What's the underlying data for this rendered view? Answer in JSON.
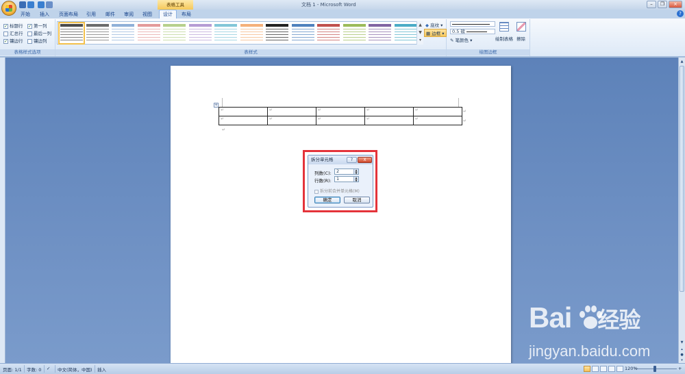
{
  "window": {
    "title": "文档 1 - Microsoft Word",
    "context_tool": "表格工具"
  },
  "tabs": [
    {
      "label": "开始"
    },
    {
      "label": "插入"
    },
    {
      "label": "页面布局"
    },
    {
      "label": "引用"
    },
    {
      "label": "邮件"
    },
    {
      "label": "审阅"
    },
    {
      "label": "视图"
    },
    {
      "label": "设计",
      "active": true
    },
    {
      "label": "布局"
    }
  ],
  "ribbon": {
    "style_options": {
      "group_label": "表格样式选项",
      "items": [
        {
          "label": "标题行",
          "checked": true
        },
        {
          "label": "第一列",
          "checked": true
        },
        {
          "label": "汇总行",
          "checked": false
        },
        {
          "label": "最后一列",
          "checked": false
        },
        {
          "label": "镶边行",
          "checked": true
        },
        {
          "label": "镶边列",
          "checked": false
        }
      ]
    },
    "table_styles": {
      "group_label": "表样式",
      "tiles": [
        {
          "color": "#4a4a4a"
        },
        {
          "color": "#6b6b6b"
        },
        {
          "color": "#8fb0d8"
        },
        {
          "color": "#e39a9a"
        },
        {
          "color": "#b6d08c"
        },
        {
          "color": "#b59cd4"
        },
        {
          "color": "#82c6d8"
        },
        {
          "color": "#f4b07a"
        },
        {
          "color": "#222222"
        },
        {
          "color": "#4f81bd"
        },
        {
          "color": "#c0504d"
        },
        {
          "color": "#9bbb59"
        },
        {
          "color": "#8064a2"
        },
        {
          "color": "#4bacc6"
        }
      ],
      "shading_label": "底纹",
      "borders_label": "边框"
    },
    "draw_borders": {
      "group_label": "绘图边框",
      "line_weight": "0.5 磅",
      "pen_color_label": "笔颜色",
      "draw_table_label": "绘制表格",
      "eraser_label": "擦除"
    }
  },
  "document": {
    "paragraph_mark": "↵",
    "move_handle": "+"
  },
  "dialog": {
    "title": "拆分单元格",
    "help": "?",
    "close": "X",
    "columns_label": "列数(C):",
    "columns_value": "2",
    "rows_label": "行数(R):",
    "rows_value": "1",
    "merge_label": "拆分前合并单元格(M)",
    "ok_label": "确定",
    "cancel_label": "取消"
  },
  "status_bar": {
    "page": "页面: 1/1",
    "words": "字数: 0",
    "language": "中文(简体，中国)",
    "mode": "插入",
    "zoom": "120%"
  },
  "watermark": {
    "logo": "Bai",
    "logo_tail": "经验",
    "url": "jingyan.baidu.com"
  }
}
